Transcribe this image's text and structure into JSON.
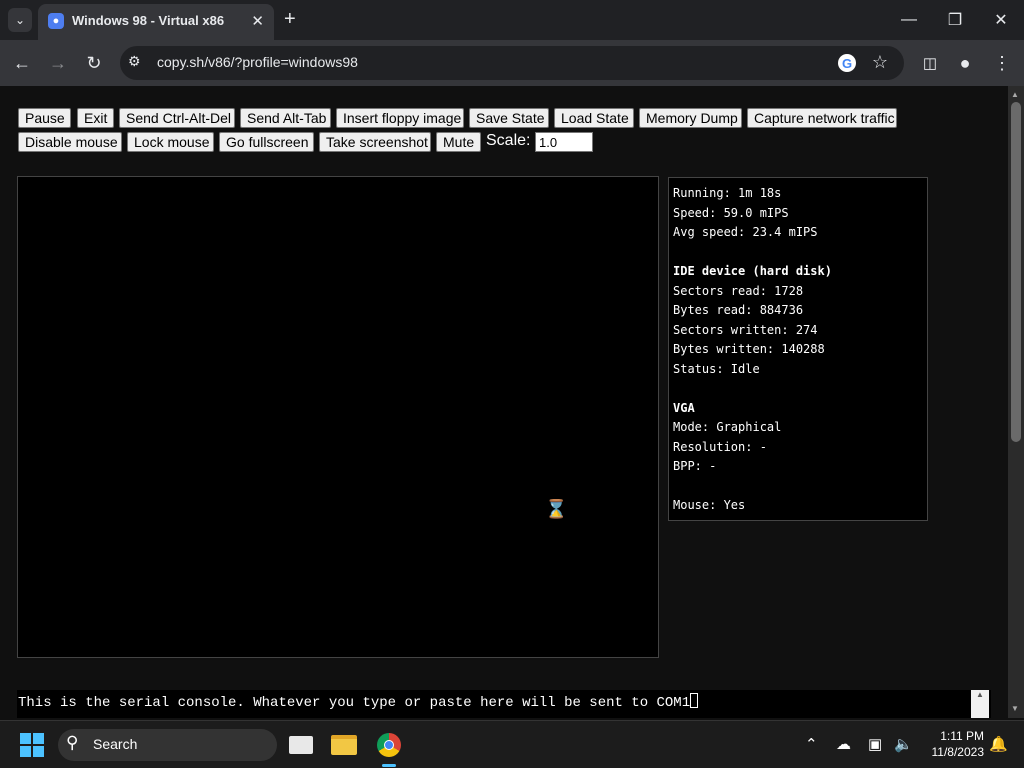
{
  "browser": {
    "tab_title": "Windows 98 - Virtual x86",
    "url": "copy.sh/v86/?profile=windows98"
  },
  "controls": {
    "row1": [
      "Pause",
      "Exit",
      "Send Ctrl-Alt-Del",
      "Send Alt-Tab",
      "Insert floppy image",
      "Save State",
      "Load State",
      "Memory Dump",
      "Capture network traffic"
    ],
    "row2": [
      "Disable mouse",
      "Lock mouse",
      "Go fullscreen",
      "Take screenshot",
      "Mute"
    ],
    "scale_label": "Scale:",
    "scale_value": "1.0"
  },
  "info": {
    "running": "Running: 1m 18s",
    "speed": "Speed: 59.0 mIPS",
    "avg_speed": "Avg speed: 23.4 mIPS",
    "ide_header": "IDE device (hard disk)",
    "sectors_read": "Sectors read: 1728",
    "bytes_read": "Bytes read: 884736",
    "sectors_written": "Sectors written: 274",
    "bytes_written": "Bytes written: 140288",
    "status": "Status: Idle",
    "vga_header": "VGA",
    "mode": "Mode: Graphical",
    "resolution": "Resolution: -",
    "bpp": "BPP: -",
    "mouse": "Mouse: Yes"
  },
  "serial": {
    "text": "This is the serial console. Whatever you type or paste here will be sent to COM1"
  },
  "taskbar": {
    "search_label": "Search",
    "time": "1:11 PM",
    "date": "11/8/2023"
  },
  "colors": {
    "page_bg": "#101010",
    "chrome_dark": "#202124",
    "chrome_toolbar": "#35363a",
    "taskbar_accent": "#4cc2ff"
  }
}
